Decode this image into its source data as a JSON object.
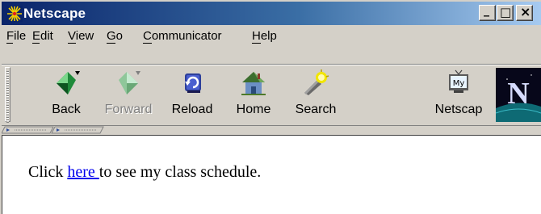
{
  "window": {
    "title": "Netscape",
    "controls": {
      "minimize": "_",
      "maximize": "□",
      "close": "×"
    }
  },
  "menu": {
    "items": [
      "File",
      "Edit",
      "View",
      "Go",
      "Communicator",
      "Help"
    ]
  },
  "toolbar": {
    "buttons": [
      {
        "label": "Back",
        "icon": "back-arrow-icon",
        "enabled": true
      },
      {
        "label": "Forward",
        "icon": "forward-arrow-icon",
        "enabled": false
      },
      {
        "label": "Reload",
        "icon": "reload-icon",
        "enabled": true
      },
      {
        "label": "Home",
        "icon": "home-icon",
        "enabled": true
      },
      {
        "label": "Search",
        "icon": "search-flashlight-icon",
        "enabled": true
      },
      {
        "label": "Netscap",
        "icon": "my-netscape-icon",
        "enabled": true
      }
    ],
    "logo_letter": "N"
  },
  "content": {
    "before_link": "Click ",
    "link_text": "here ",
    "after_link": "to see my class schedule."
  },
  "colors": {
    "title_gradient_start": "#0a246a",
    "title_gradient_end": "#a6caf0",
    "chrome": "#d4d0c8",
    "link": "#0000ee"
  }
}
